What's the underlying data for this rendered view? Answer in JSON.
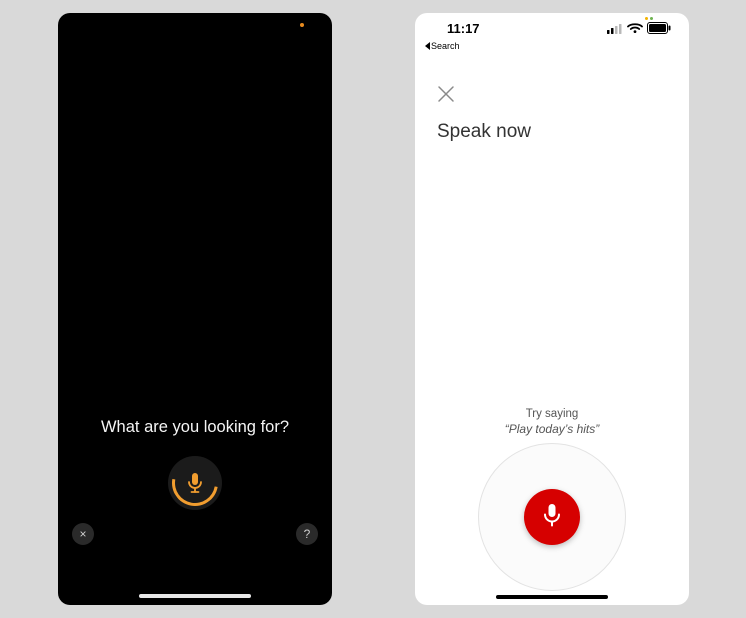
{
  "left": {
    "prompt": "What are you looking for?",
    "mic_color": "#f19d2f",
    "close_symbol": "×",
    "help_symbol": "?"
  },
  "right": {
    "status": {
      "time": "11:17",
      "back_label": "Search"
    },
    "heading": "Speak now",
    "hint_label": "Try saying",
    "hint_phrase": "“Play today’s hits”",
    "mic_color": "#d60000"
  }
}
